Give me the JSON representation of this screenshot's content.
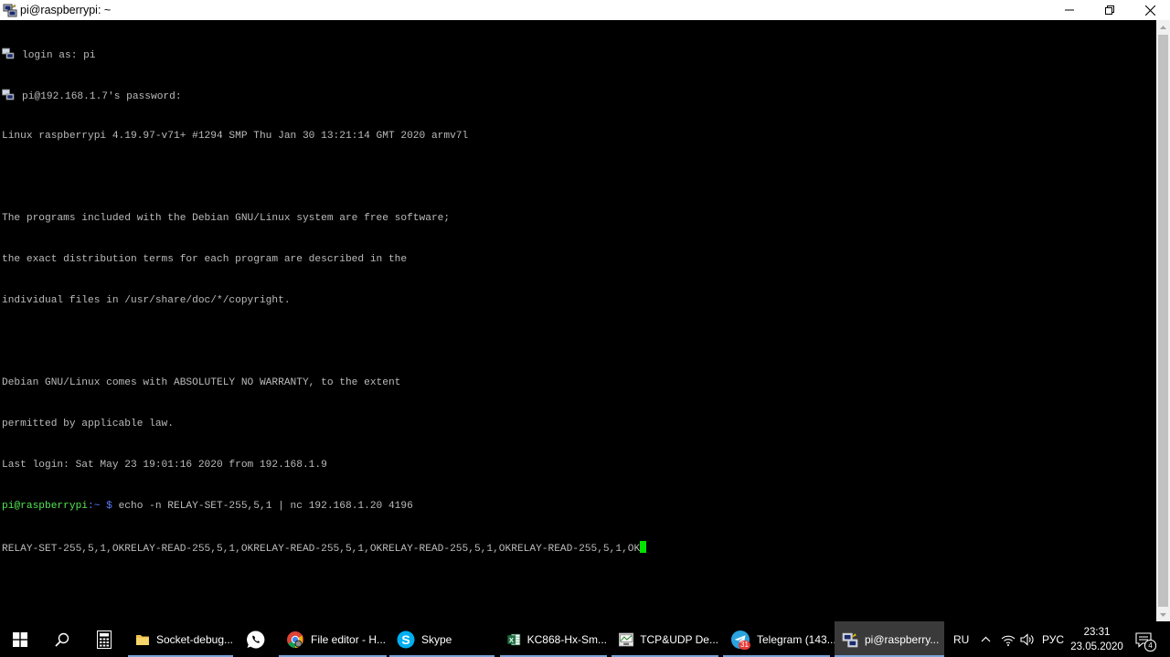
{
  "window": {
    "title": "pi@raspberrypi: ~",
    "controls": {
      "minimize": "minimize",
      "maximize": "restore",
      "close": "close"
    }
  },
  "terminal": {
    "login_line": "login as: pi",
    "password_line": "pi@192.168.1.7's password:",
    "lines": [
      "Linux raspberrypi 4.19.97-v71+ #1294 SMP Thu Jan 30 13:21:14 GMT 2020 armv7l",
      "",
      "The programs included with the Debian GNU/Linux system are free software;",
      "the exact distribution terms for each program are described in the",
      "individual files in /usr/share/doc/*/copyright.",
      "",
      "Debian GNU/Linux comes with ABSOLUTELY NO WARRANTY, to the extent",
      "permitted by applicable law.",
      "Last login: Sat May 23 19:01:16 2020 from 192.168.1.9"
    ],
    "prompt_user": "pi@raspberrypi",
    "prompt_path": ":~ $",
    "command": " echo -n RELAY-SET-255,5,1 | nc 192.168.1.20 4196",
    "output": "RELAY-SET-255,5,1,OKRELAY-READ-255,5,1,OKRELAY-READ-255,5,1,OKRELAY-READ-255,5,1,OKRELAY-READ-255,5,1,OK"
  },
  "taskbar": {
    "apps": [
      {
        "label": "Socket-debug...",
        "icon": "folder-icon"
      },
      {
        "label": "",
        "icon": "whatsapp-icon"
      },
      {
        "label": "File editor - H...",
        "icon": "chrome-icon"
      },
      {
        "label": "Skype",
        "icon": "skype-icon"
      },
      {
        "label": "KC868-Hx-Sm...",
        "icon": "excel-icon"
      },
      {
        "label": "TCP&UDP De...",
        "icon": "tcpudp-icon"
      },
      {
        "label": "Telegram (143...",
        "icon": "telegram-icon",
        "badge": "31"
      },
      {
        "label": "pi@raspberry...",
        "icon": "putty-icon"
      }
    ],
    "tray": {
      "lang": "RU",
      "keyboard": "РУС",
      "time": "23:31",
      "date": "23.05.2020",
      "notifications": "4"
    }
  },
  "colors": {
    "terminal_bg": "#000000",
    "terminal_fg": "#bbbbbb",
    "prompt_user": "#54e654",
    "prompt_path": "#5c7cff",
    "cursor": "#00e400",
    "taskbar_bg": "#000000",
    "taskbar_underline": "#7aa3d8"
  }
}
